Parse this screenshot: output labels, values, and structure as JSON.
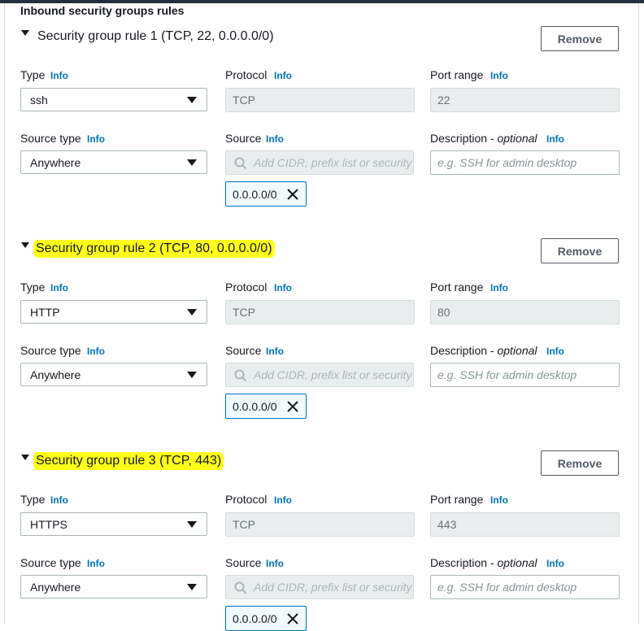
{
  "section_title": "Inbound security groups rules",
  "labels": {
    "type": "Type",
    "protocol": "Protocol",
    "port_range": "Port range",
    "source_type": "Source type",
    "source": "Source",
    "description": "Description - ",
    "optional": "optional",
    "info": "Info"
  },
  "remove_label": "Remove",
  "source_placeholder": "Add CIDR, prefix list or security group",
  "description_placeholder": "e.g. SSH for admin desktop",
  "highlight_color": "#ffff1a",
  "rules": [
    {
      "title": "Security group rule 1 (TCP, 22, 0.0.0.0/0)",
      "type": "ssh",
      "protocol": "TCP",
      "port_range": "22",
      "source_type": "Anywhere",
      "token": "0.0.0.0/0",
      "highlighted": false
    },
    {
      "title": "Security group rule 2 (TCP, 80, 0.0.0.0/0)",
      "type": "HTTP",
      "protocol": "TCP",
      "port_range": "80",
      "source_type": "Anywhere",
      "token": "0.0.0.0/0",
      "highlighted": true
    },
    {
      "title": "Security group rule 3 (TCP, 443)",
      "type": "HTTPS",
      "protocol": "TCP",
      "port_range": "443",
      "source_type": "Anywhere",
      "token": "0.0.0.0/0",
      "highlighted": true
    }
  ]
}
